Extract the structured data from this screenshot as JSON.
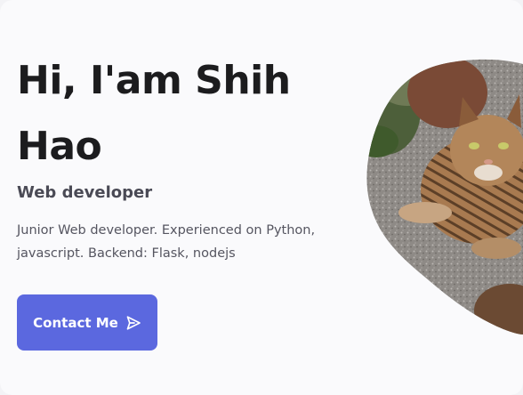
{
  "hero": {
    "title": "Hi, I'am Shih Hao",
    "subtitle": "Web developer",
    "description": "Junior Web developer. Experienced on Python, javascript. Backend: Flask, nodejs",
    "contact_label": "Contact Me"
  },
  "icons": {
    "send": "send-icon"
  },
  "colors": {
    "primary": "#5b68df",
    "title": "#1c1c1e",
    "subtitle": "#4a4a55",
    "text": "#555560",
    "background": "#fafafc"
  }
}
